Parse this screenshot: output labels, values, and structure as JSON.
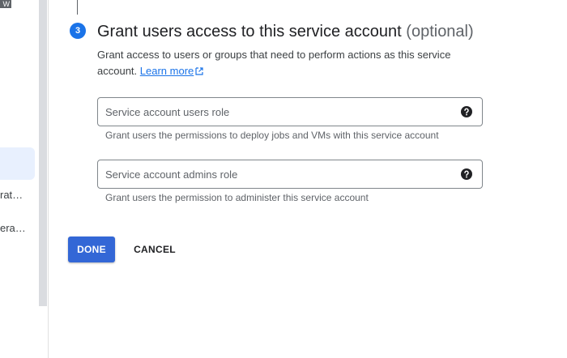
{
  "sidebar": {
    "badge": "W",
    "items": [
      {
        "label": "rat…"
      },
      {
        "label": "era…"
      }
    ]
  },
  "step": {
    "number": "3",
    "title": "Grant users access to this service account",
    "title_suffix": "(optional)",
    "description": "Grant access to users or groups that need to perform actions as this service account.",
    "learn_more": "Learn more"
  },
  "fields": [
    {
      "placeholder": "Service account users role",
      "hint": "Grant users the permissions to deploy jobs and VMs with this service account",
      "icon": "help-icon"
    },
    {
      "placeholder": "Service account admins role",
      "hint": "Grant users the permission to administer this service account",
      "icon": "help-icon"
    }
  ],
  "actions": {
    "done_label": "DONE",
    "cancel_label": "CANCEL"
  },
  "colors": {
    "accent": "#1a73e8",
    "done_button": "#3367d6"
  }
}
